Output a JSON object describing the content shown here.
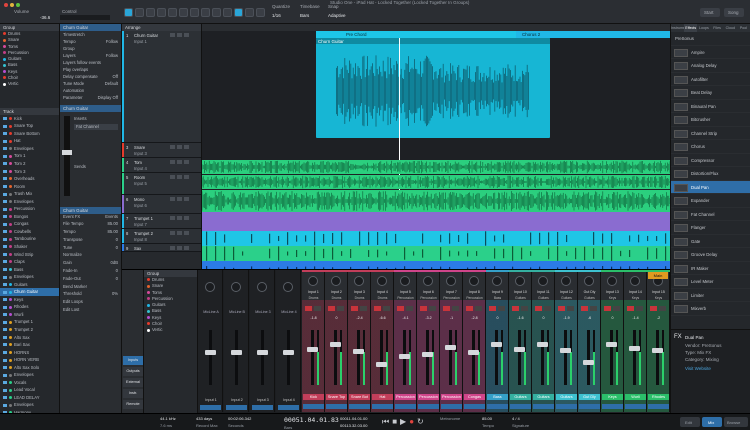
{
  "window": {
    "title": "Studio One - iPad Hat - Locked Together (Locked Together In Groups)"
  },
  "toolbar": {
    "volume_label": "Volume",
    "control_label": "Control",
    "volume_value": "-36.6",
    "quantize_label": "Quantize",
    "quantize_value": "1/16",
    "timebase_label": "Timebase",
    "timebase_value": "Bars",
    "snap_label": "Snap",
    "snap_value": "Adaptive",
    "start_label": "Start",
    "song_label": "Song"
  },
  "browser": {
    "group_header": "Group",
    "groups": [
      "Drums",
      "Snare",
      "Toms",
      "Percussion",
      "Guitars",
      "Bass",
      "Keys",
      "Choir",
      "Vertic"
    ],
    "group_colors": [
      "#e53b2c",
      "#e5632c",
      "#d64a9a",
      "#c23e86",
      "#20b7e6",
      "#35c2d0",
      "#b54ed0",
      "#e53b2c",
      "#ffffff"
    ],
    "track_header": "Track",
    "tracks": [
      "Kick",
      "Snare Top",
      "Snare Bottom",
      "Hat",
      "Envelopes",
      "Tom 1",
      "Tom 2",
      "Tom 3",
      "Overheads",
      "Room",
      "Trash Mix",
      "Envelopes",
      "Percussion",
      "Bongos",
      "Congas",
      "Cowbells",
      "Tambourine",
      "Shaker",
      "Wind Strip",
      "Claps",
      "Bass",
      "Envelopes",
      "Guitars",
      "Churn Guitar",
      "Keys",
      "Rhodes",
      "Wurli",
      "Trumpet 1",
      "Trumpet 2",
      "Alto Sax",
      "Bari Sax",
      "HORNS",
      "HORN VERB",
      "Alto Sax Solo",
      "Envelopes",
      "Vocals",
      "Lead Vocal",
      "LEAD DELAY",
      "Envelopes",
      "Harmony"
    ],
    "track_colors": [
      "#e53b2c",
      "#e53b2c",
      "#e53b2c",
      "#e53b2c",
      "#777",
      "#d64a9a",
      "#d64a9a",
      "#d64a9a",
      "#e5632c",
      "#e5632c",
      "#777",
      "#777",
      "#c23e86",
      "#c23e86",
      "#c23e86",
      "#c23e86",
      "#c23e86",
      "#c23e86",
      "#c23e86",
      "#c23e86",
      "#35c2d0",
      "#777",
      "#20b7e6",
      "#20b7e6",
      "#b54ed0",
      "#b54ed0",
      "#b54ed0",
      "#e0a020",
      "#e0a020",
      "#e0a020",
      "#e0a020",
      "#e0a020",
      "#e0a020",
      "#e0a020",
      "#777",
      "#2bd08a",
      "#2bd08a",
      "#2bd08a",
      "#777",
      "#2bd08a"
    ]
  },
  "inspector": {
    "track_name": "Churn Guitar",
    "rows": [
      {
        "label": "Timestretch",
        "value": ""
      },
      {
        "label": "Tempo",
        "value": "Follow"
      },
      {
        "label": "Group",
        "value": ""
      },
      {
        "label": "Layers",
        "value": "Follow"
      },
      {
        "label": "Layers follow events",
        "value": ""
      },
      {
        "label": "Play overlaps",
        "value": ""
      },
      {
        "label": "Delay compensate",
        "value": "Off"
      },
      {
        "label": "Tune Mode",
        "value": "Default"
      },
      {
        "label": "Automation",
        "value": ""
      },
      {
        "label": "Parameter",
        "value": "Display Off"
      }
    ],
    "channel_name": "Churn Guitar",
    "inserts_label": "Inserts",
    "insert_fx": "Fat Channel",
    "sends_label": "Sends",
    "event_fx_label": "Event FX",
    "events_label": "Events",
    "event_rows": [
      {
        "label": "File Tempo",
        "value": "85.00"
      },
      {
        "label": "Tempo",
        "value": "85.00"
      },
      {
        "label": "Transpose",
        "value": "0"
      },
      {
        "label": "Tune",
        "value": "0"
      },
      {
        "label": "Normalize",
        "value": ""
      },
      {
        "label": "Gain",
        "value": "0dB"
      },
      {
        "label": "Fade-In",
        "value": "0"
      },
      {
        "label": "Fade-Out",
        "value": "0"
      },
      {
        "label": "Bend Marker",
        "value": ""
      },
      {
        "label": "Threshold",
        "value": "0%"
      },
      {
        "label": "Edit Loops",
        "value": ""
      },
      {
        "label": "Edit Lost",
        "value": ""
      }
    ]
  },
  "arrange": {
    "tab_label": "Arrange",
    "markers": [
      "Pre Chord",
      "Chorus 2"
    ],
    "clip_name": "Churn Guitar",
    "tracks": [
      {
        "num": "1",
        "name": "Churn Guitar",
        "color": "#20b7e6",
        "input": "Input 1",
        "output": "Guitars"
      },
      {
        "num": "2",
        "name": "Kick",
        "color": "#e53b2c",
        "input": "Input 2",
        "output": "Drums"
      },
      {
        "num": "3",
        "name": "Snare",
        "color": "#e53b2c",
        "input": "Input 3",
        "output": "Drums"
      },
      {
        "num": "4",
        "name": "Tom",
        "color": "#2bd08a",
        "input": "Input 4",
        "output": "Toms"
      },
      {
        "num": "5",
        "name": "Room",
        "color": "#2bd08a",
        "input": "Input 5",
        "output": "Drums"
      },
      {
        "num": "6",
        "name": "Mono",
        "color": "#8a6cd0",
        "input": "Input 6",
        "output": "Main"
      },
      {
        "num": "7",
        "name": "Trumpet 1",
        "color": "#20b7e6",
        "input": "Input 7",
        "output": "Horns"
      },
      {
        "num": "8",
        "name": "Trumpet 2",
        "color": "#20b7e6",
        "input": "Input 8",
        "output": "Horns"
      },
      {
        "num": "9",
        "name": "Sax",
        "color": "#2b7be6",
        "input": "Input 9",
        "output": "Horns"
      }
    ],
    "audio_label": "Audio",
    "out_label": "Out Dly",
    "fx_label": "FX",
    "normal_label": "Normal"
  },
  "mixer": {
    "group_header": "Group",
    "groups": [
      "Drums",
      "Snare",
      "Toms",
      "Percussion",
      "Guitars",
      "Bass",
      "Keys",
      "Choir",
      "Vertic"
    ],
    "channels": [
      {
        "name": "Kick",
        "color": "#c23e5a",
        "label": "Input 1",
        "route": "Drums",
        "val": "-1.8"
      },
      {
        "name": "Snare Top",
        "color": "#c23e5a",
        "label": "Input 2",
        "route": "Drums",
        "val": "0"
      },
      {
        "name": "Snare Bot",
        "color": "#c23e5a",
        "label": "Input 3",
        "route": "Drums",
        "val": "-2.4"
      },
      {
        "name": "Hat",
        "color": "#c23e5a",
        "label": "Input 4",
        "route": "Drums",
        "val": "-6.6"
      },
      {
        "name": "Percussion",
        "color": "#d0458a",
        "label": "Input 5",
        "route": "Percussion",
        "val": "-4.1"
      },
      {
        "name": "Percussion",
        "color": "#d0458a",
        "label": "Input 6",
        "route": "Percussion",
        "val": "-3.2"
      },
      {
        "name": "Percussion",
        "color": "#d0458a",
        "label": "Input 7",
        "route": "Percussion",
        "val": "-1"
      },
      {
        "name": "Congas",
        "color": "#d0458a",
        "label": "Input 8",
        "route": "Percussion",
        "val": "-2.8"
      },
      {
        "name": "Bass",
        "color": "#35a0c8",
        "label": "Input 9",
        "route": "Bass",
        "val": "0"
      },
      {
        "name": "Guitars",
        "color": "#35b0a0",
        "label": "Input 10",
        "route": "Guitars",
        "val": "-1.6"
      },
      {
        "name": "Guitars",
        "color": "#35b0a0",
        "label": "Input 11",
        "route": "Guitars",
        "val": "0"
      },
      {
        "name": "Guitars",
        "color": "#3ec2d0",
        "label": "Input 12",
        "route": "Guitars",
        "val": "-1.9"
      },
      {
        "name": "Gut Dly",
        "color": "#3ec2d0",
        "label": "Gut Dly",
        "route": "Guitars",
        "val": "-6"
      },
      {
        "name": "Keys",
        "color": "#2bbf6a",
        "label": "Input 13",
        "route": "Keys",
        "val": "0"
      },
      {
        "name": "Wurli",
        "color": "#2bbf6a",
        "label": "Input 14",
        "route": "Keys",
        "val": "-1.4"
      },
      {
        "name": "Rhodes",
        "color": "#2bbf6a",
        "label": "Input 15",
        "route": "Keys",
        "val": "-2"
      }
    ],
    "mono_labels": [
      "MicLine A",
      "MicLine B",
      "MicLine 3",
      "MicLine 4"
    ],
    "input_labels": [
      "Input 1",
      "Input 2",
      "Input 3",
      "Input 4"
    ],
    "main_label": "Main",
    "side_buttons": [
      "Inputs",
      "Outputs",
      "External",
      "Instr.",
      "Remote"
    ],
    "mix_label": "Mix"
  },
  "browser_right": {
    "tabs": [
      "Instruments",
      "Effects",
      "Loops",
      "Files",
      "Cloud",
      "Pool"
    ],
    "items": [
      "PreSonus",
      "Ampire",
      "Analog Delay",
      "Autofilter",
      "Beat Delay",
      "Binaural Pan",
      "Bitcrusher",
      "Channel Strip",
      "Chorus",
      "Compressor",
      "Distortion/Flux",
      "Dual Pan",
      "Expander",
      "Fat Channel",
      "Flanger",
      "Gate",
      "Groove Delay",
      "IR Maker",
      "Level Meter",
      "Limiter",
      "Mixverb"
    ],
    "selected_index": 11,
    "footer_title": "Dual Pan",
    "footer_rows": [
      "Vendor: PreSonus",
      "Type: Mix FX",
      "Category: Mixing"
    ],
    "footer_link": "Visit Website"
  },
  "transport": {
    "sample_rate": "44.1 kHz",
    "rate_sub": "7.6 ms",
    "record_max": "433 days",
    "record_sub": "Record Max",
    "seconds": "00:02:06.342",
    "seconds_sub": "Seconds",
    "position": "00051.04.01.83",
    "position_sub": "Bars",
    "loop_start": "00011.04.01.00",
    "loop_end": "00113.32.03.00",
    "tempo": "85.00",
    "tempo_sub": "Tempo",
    "sig": "4 / 4",
    "sig_sub": "Signature",
    "metronome": "Metronome",
    "edit_btn": "Edit",
    "mix_btn": "Mix",
    "browse_btn": "Browse"
  }
}
